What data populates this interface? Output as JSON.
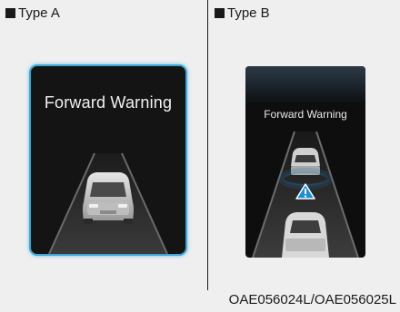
{
  "panels": [
    {
      "label": "Type A",
      "screen_text": "Forward Warning"
    },
    {
      "label": "Type B",
      "screen_text": "Forward Warning"
    }
  ],
  "colors": {
    "background": "#efefef",
    "screen_a_border": "#3aa8d8",
    "warning_blue": "#1e8fd0",
    "warning_triangle": "#ffffff"
  },
  "icons": [
    "car-icon",
    "warning-triangle-icon"
  ],
  "figure_code": "OAE056024L/OAE056025L"
}
